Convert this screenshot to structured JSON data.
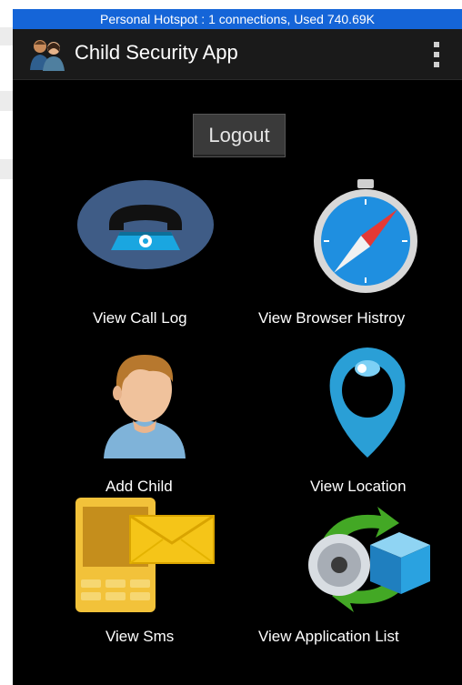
{
  "status_bar": {
    "text": "Personal Hotspot : 1 connections, Used 740.69K"
  },
  "action_bar": {
    "title": "Child Security App",
    "menu_icon": "overflow-menu-icon"
  },
  "logout": {
    "label": "Logout"
  },
  "tiles": [
    {
      "label": "View Call Log",
      "icon": "telephone-icon"
    },
    {
      "label": "View Browser Histroy",
      "icon": "compass-icon"
    },
    {
      "label": "Add Child",
      "icon": "child-avatar-icon"
    },
    {
      "label": "View Location",
      "icon": "location-pin-icon"
    },
    {
      "label": "View Sms",
      "icon": "sms-phone-icon"
    },
    {
      "label": "View Application List",
      "icon": "application-box-icon"
    }
  ],
  "colors": {
    "status_bar": "#1565d8",
    "action_bar": "#1a1a1a",
    "background": "#000000",
    "accent_blue": "#1f8fe0"
  }
}
